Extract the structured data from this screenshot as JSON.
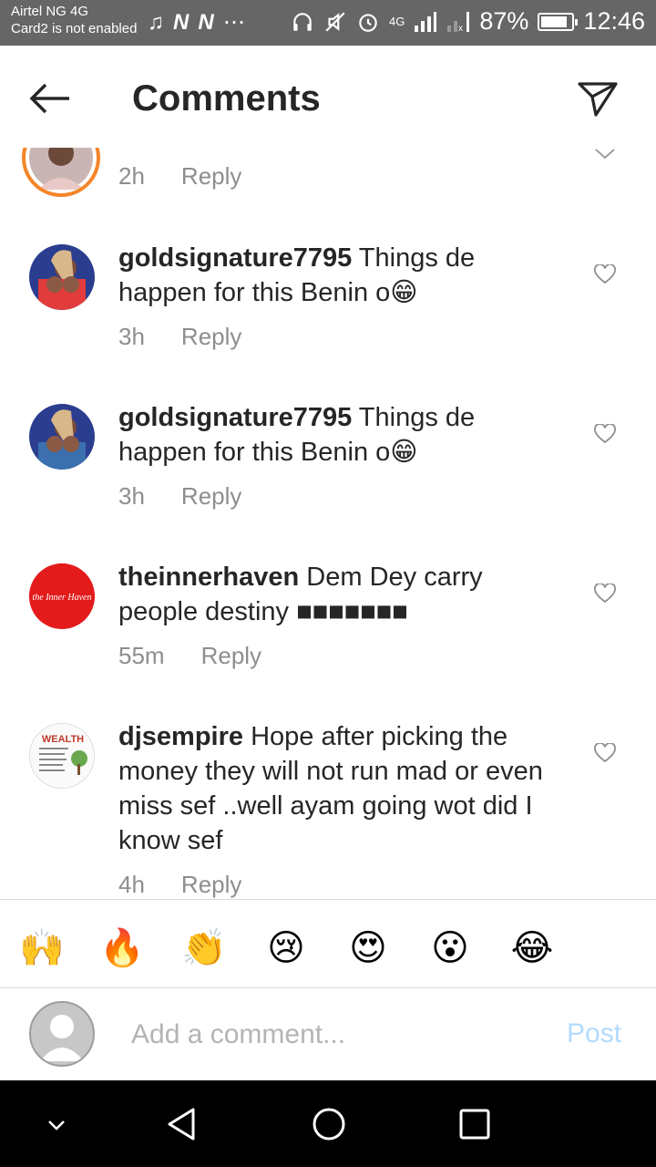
{
  "status_bar": {
    "carrier_line1": "Airtel NG 4G",
    "carrier_line2": "Card2 is not enabled",
    "network": "4G",
    "battery": "87%",
    "battery_level": 0.87,
    "time": "12:46",
    "icons": [
      "music-icon",
      "notification-n-icon",
      "notification-n-icon",
      "more-dots-icon",
      "headset-icon",
      "mute-icon",
      "alarm-icon",
      "signal-icon",
      "signal-x-icon",
      "battery-icon"
    ]
  },
  "header": {
    "title": "Comments"
  },
  "comments": [
    {
      "username": "",
      "text": "",
      "time": "2h",
      "reply_label": "Reply"
    },
    {
      "username": "goldsignature7795",
      "text": "Things de happen for this Benin o😁",
      "time": "3h",
      "reply_label": "Reply"
    },
    {
      "username": "goldsignature7795",
      "text": "Things de happen for this Benin o😁",
      "time": "3h",
      "reply_label": "Reply"
    },
    {
      "username": "theinnerhaven",
      "text": "Dem Dey carry people destiny ■■■■■■■",
      "time": "55m",
      "reply_label": "Reply"
    },
    {
      "username": "djsempire",
      "text": "Hope after picking the money they will not run mad or even miss sef ..well ayam going wot did I know sef",
      "time": "4h",
      "reply_label": "Reply"
    }
  ],
  "avatar_text": {
    "theinnerhaven": "the Inner Haven",
    "djsempire": "WEALTH"
  },
  "emoji_bar": [
    "🙌",
    "🔥",
    "👏",
    "😢",
    "😍",
    "😮",
    "😂"
  ],
  "composer": {
    "placeholder": "Add a comment...",
    "post_label": "Post"
  },
  "colors": {
    "accent_post": "#b3dbff",
    "meta_gray": "#8e8e8e",
    "status_bar": "#666666"
  }
}
